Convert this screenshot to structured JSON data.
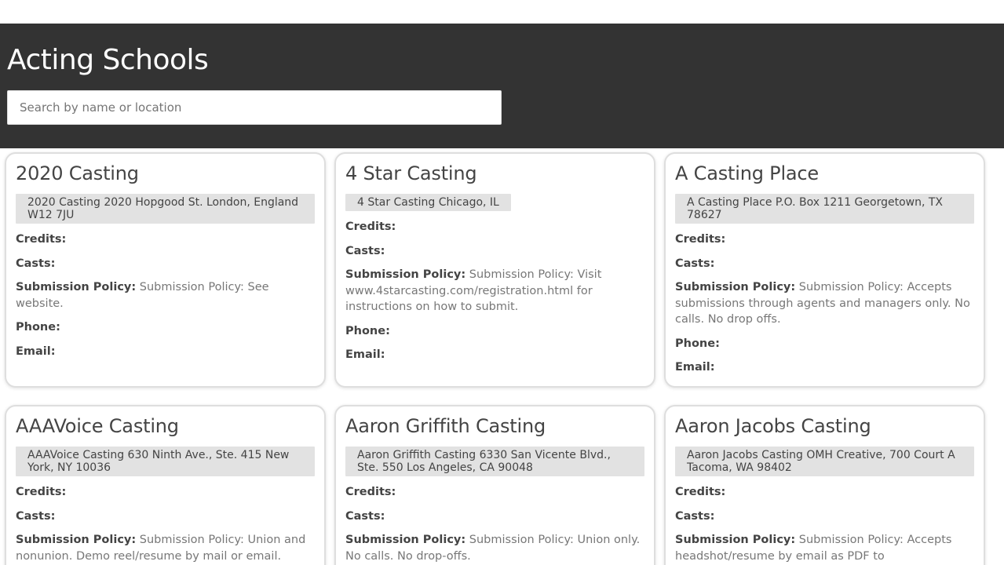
{
  "header": {
    "title": "Acting Schools",
    "search_placeholder": "Search by name or location"
  },
  "labels": {
    "credits": "Credits:",
    "casts": "Casts:",
    "submission_policy": "Submission Policy:",
    "phone": "Phone:",
    "email": "Email:"
  },
  "cards": [
    {
      "name": "2020 Casting",
      "address": "2020 Casting 2020 Hopgood St. London, England W12 7JU",
      "submission_policy": "Submission Policy: See website."
    },
    {
      "name": "4 Star Casting",
      "address": "4 Star Casting Chicago, IL",
      "submission_policy": "Submission Policy: Visit www.4starcasting.com/registration.html for instructions on how to submit."
    },
    {
      "name": "A Casting Place",
      "address": "A Casting Place P.O. Box 1211 Georgetown, TX 78627",
      "submission_policy": "Submission Policy: Accepts submissions through agents and managers only. No calls. No drop offs."
    },
    {
      "name": "AAAVoice Casting",
      "address": "AAAVoice Casting 630 Ninth Ave., Ste. 415 New York, NY 10036",
      "submission_policy": "Submission Policy: Union and nonunion. Demo reel/resume by mail or email. Address"
    },
    {
      "name": "Aaron Griffith Casting",
      "address": "Aaron Griffith Casting 6330 San Vicente Blvd., Ste. 550 Los Angeles, CA 90048",
      "submission_policy": "Submission Policy: Union only. No calls. No drop-offs."
    },
    {
      "name": "Aaron Jacobs Casting",
      "address": "Aaron Jacobs Casting OMH Creative, 700 Court A Tacoma, WA 98402",
      "submission_policy": "Submission Policy: Accepts headshot/resume by email as PDF to"
    }
  ]
}
